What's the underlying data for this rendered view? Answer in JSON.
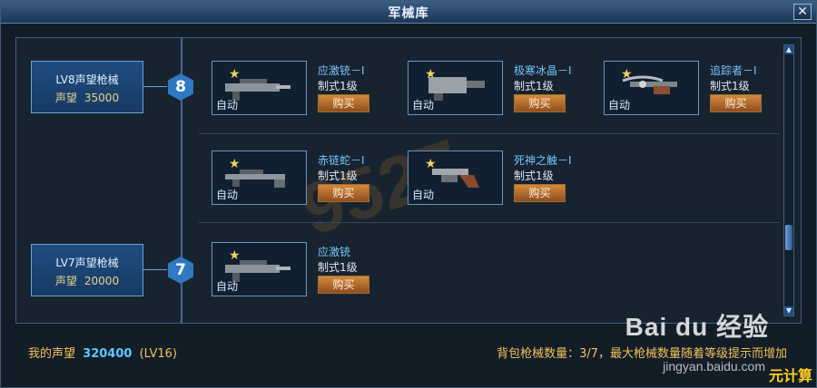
{
  "window": {
    "title": "军械库",
    "close_label": "✕"
  },
  "groups": [
    {
      "rank_title": "LV8声望枪械",
      "reputation_label": "声望",
      "reputation_required": "35000",
      "level": "8",
      "items": [
        {
          "name": "应激铳－I",
          "rank": "制式1级",
          "buy_label": "购买",
          "badge": "自动",
          "icon": "rifle-icon"
        },
        {
          "name": "极寒冰晶－I",
          "rank": "制式1级",
          "buy_label": "购买",
          "badge": "自动",
          "icon": "heavy-gun-icon"
        },
        {
          "name": "追踪者－I",
          "rank": "制式1级",
          "buy_label": "购买",
          "badge": "自动",
          "icon": "crossbow-icon"
        },
        {
          "name": "赤链蛇－I",
          "rank": "制式1级",
          "buy_label": "购买",
          "badge": "自动",
          "icon": "sniper-icon"
        },
        {
          "name": "死神之触－I",
          "rank": "制式1级",
          "buy_label": "购买",
          "badge": "自动",
          "icon": "revolver-icon"
        }
      ]
    },
    {
      "rank_title": "LV7声望枪械",
      "reputation_label": "声望",
      "reputation_required": "20000",
      "level": "7",
      "items": [
        {
          "name": "应激铳",
          "rank": "制式1级",
          "buy_label": "购买",
          "badge": "自动",
          "icon": "rifle-icon"
        }
      ]
    }
  ],
  "footer": {
    "my_reputation_label": "我的声望",
    "my_reputation_value": "320400",
    "my_level": "(LV16)",
    "backpack_text": "背包枪械数量：3/7，最大枪械数量随着等级提示而增加"
  },
  "watermarks": {
    "baidu": "Bai du 经验",
    "url": "jingyan.baidu.com",
    "corner": "元计算",
    "center": "9527"
  }
}
